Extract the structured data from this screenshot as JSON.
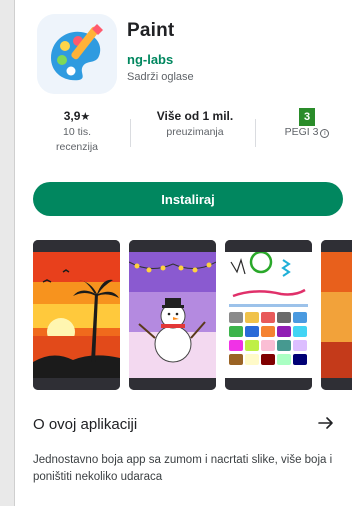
{
  "app": {
    "title": "Paint",
    "developer": "ng-labs",
    "ads_note": "Sadrži oglase"
  },
  "stats": {
    "rating_value": "3,9",
    "rating_star": "★",
    "reviews_count": "10 tis.",
    "reviews_label": "recenzija",
    "downloads_value": "Više od 1 mil.",
    "downloads_label": "preuzimanja",
    "pegi_badge": "3",
    "pegi_label": "PEGI 3",
    "pegi_info": "i"
  },
  "install_button": {
    "label": "Instaliraj"
  },
  "screenshots": [
    {
      "name": "sunset-palm-screenshot"
    },
    {
      "name": "snowman-screenshot"
    },
    {
      "name": "color-picker-screenshot"
    },
    {
      "name": "partial-screenshot"
    }
  ],
  "about": {
    "title": "O ovoj aplikaciji",
    "description": "Jednostavno boja app sa zumom i nacrtati slike, više boja i poništiti nekoliko udaraca"
  },
  "colors": {
    "accent": "#01875f",
    "pegi_green": "#2a8c2a",
    "text_primary": "#202124",
    "text_secondary": "#5f6368"
  },
  "icons": [
    "palette-icon",
    "star-icon",
    "info-icon",
    "arrow-right-icon"
  ]
}
